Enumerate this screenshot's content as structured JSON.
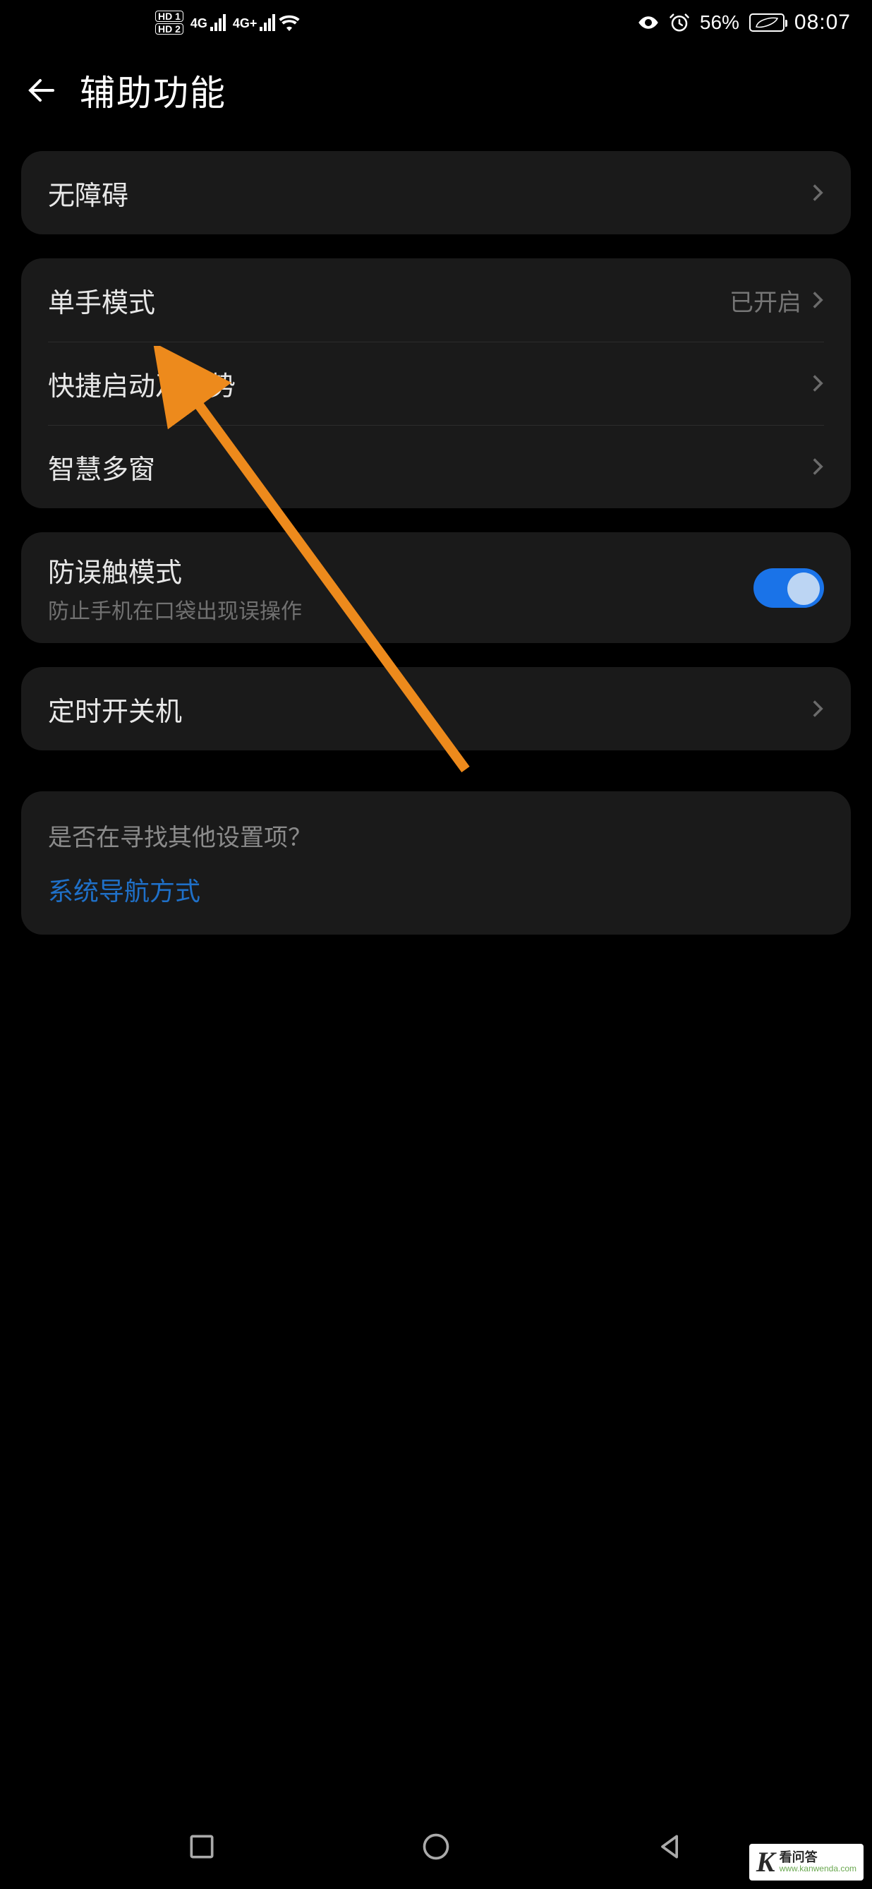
{
  "statusbar": {
    "hd1": "HD 1",
    "hd2": "HD 2",
    "net1": "4G",
    "net2": "4G+",
    "battery_pct": "56%",
    "time": "08:07"
  },
  "header": {
    "title": "辅助功能"
  },
  "groups": {
    "accessibility": "无障碍",
    "onehand": {
      "label": "单手模式",
      "value": "已开启"
    },
    "gestures": "快捷启动及手势",
    "multiwindow": "智慧多窗",
    "pocket": {
      "label": "防误触模式",
      "sub": "防止手机在口袋出现误操作"
    },
    "power_schedule": "定时开关机"
  },
  "looking": {
    "question": "是否在寻找其他设置项？",
    "link": "系统导航方式"
  },
  "watermark": {
    "logo": "K",
    "cn": "看问答",
    "url": "www.kanwenda.com"
  }
}
